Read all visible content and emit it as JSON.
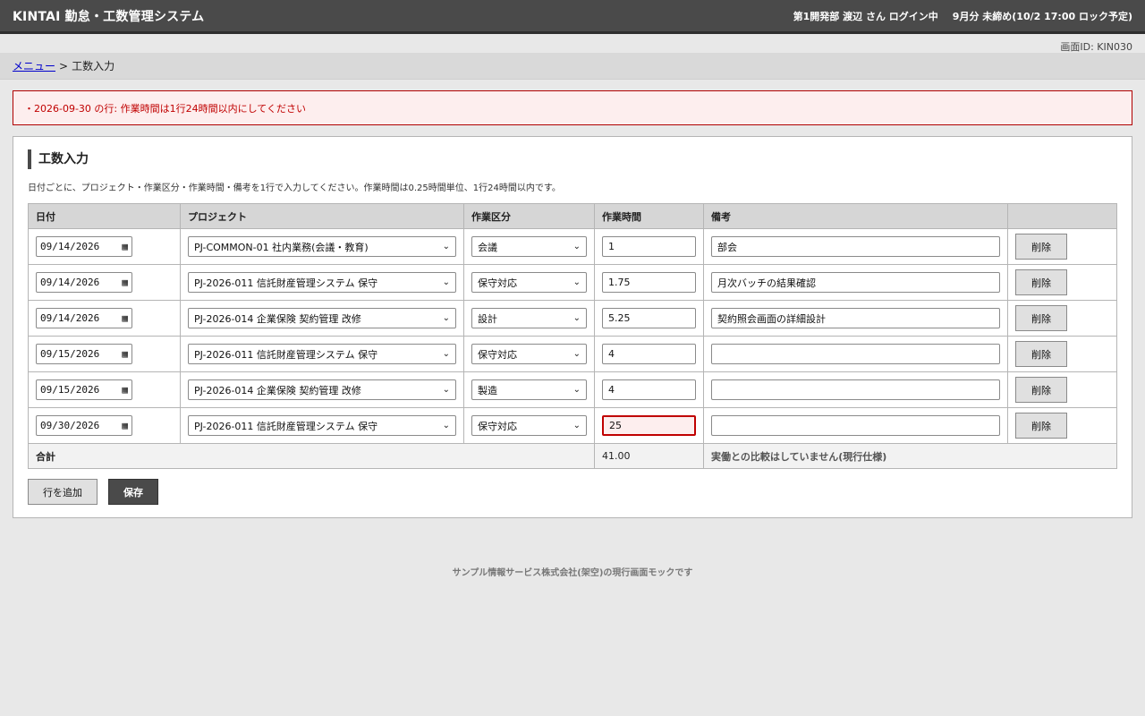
{
  "header": {
    "app_title": "KINTAI 勤怠・工数管理システム",
    "user": "第1開発部 渡辺 さん ログイン中",
    "period": "9月分 未締め(10/2 17:00 ロック予定)"
  },
  "screen_id": "画面ID: KIN030",
  "breadcrumb": {
    "menu": "メニュー",
    "separator": ">",
    "current": "工数入力"
  },
  "error": "・2026-09-30 の行: 作業時間は1行24時間以内にしてください",
  "panel": {
    "title": "工数入力",
    "description": "日付ごとに、プロジェクト・作業区分・作業時間・備考を1行で入力してください。作業時間は0.25時間単位、1行24時間以内です。"
  },
  "table": {
    "headers": [
      "日付",
      "プロジェクト",
      "作業区分",
      "作業時間",
      "備考",
      ""
    ],
    "rows": [
      {
        "date": "09/14/2026",
        "project": "PJ-COMMON-01 社内業務(会議・教育)",
        "task": "会議",
        "hours": "1",
        "note": "部会",
        "delete": "削除"
      },
      {
        "date": "09/14/2026",
        "project": "PJ-2026-011 信託財産管理システム 保守",
        "task": "保守対応",
        "hours": "1.75",
        "note": "月次バッチの結果確認",
        "delete": "削除"
      },
      {
        "date": "09/14/2026",
        "project": "PJ-2026-014 企業保険 契約管理 改修",
        "task": "設計",
        "hours": "5.25",
        "note": "契約照会画面の詳細設計",
        "delete": "削除"
      },
      {
        "date": "09/15/2026",
        "project": "PJ-2026-011 信託財産管理システム 保守",
        "task": "保守対応",
        "hours": "4",
        "note": "",
        "delete": "削除"
      },
      {
        "date": "09/15/2026",
        "project": "PJ-2026-014 企業保険 契約管理 改修",
        "task": "製造",
        "hours": "4",
        "note": "",
        "delete": "削除"
      },
      {
        "date": "09/30/2026",
        "project": "PJ-2026-011 信託財産管理システム 保守",
        "task": "保守対応",
        "hours": "25",
        "note": "",
        "delete": "削除"
      }
    ],
    "total_label": "合計",
    "total_value": "41.00",
    "total_note": "実働との比較はしていません(現行仕様)"
  },
  "actions": {
    "add_row": "行を追加",
    "save": "保存"
  },
  "footer": "サンプル情報サービス株式会社(架空)の現行画面モックです",
  "colors": {
    "header_bg": "#4a4a4a",
    "error": "#c00000",
    "error_bg": "#fdeeee",
    "link": "#0000cc"
  }
}
